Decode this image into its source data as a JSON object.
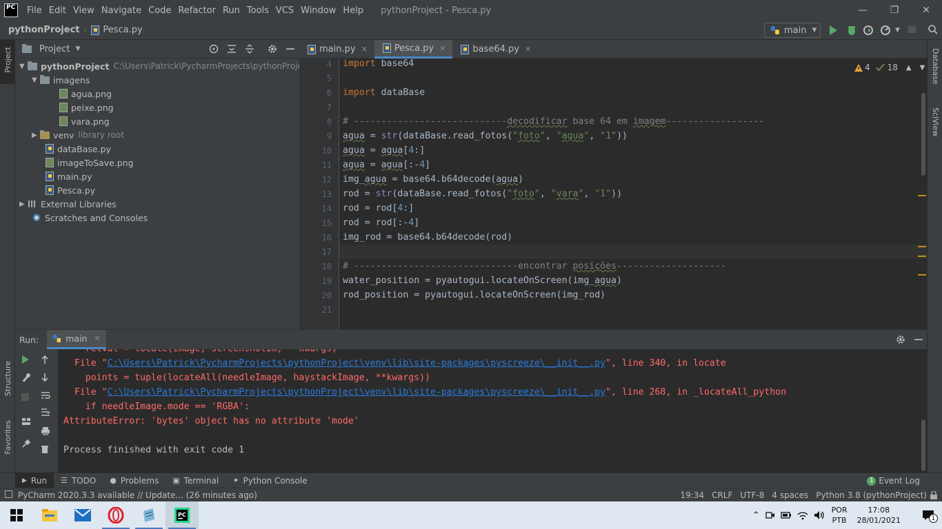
{
  "titlebar": {
    "logo": "PC",
    "menu": [
      "File",
      "Edit",
      "View",
      "Navigate",
      "Code",
      "Refactor",
      "Run",
      "Tools",
      "VCS",
      "Window",
      "Help"
    ],
    "window_title": "pythonProject - Pesca.py",
    "controls": {
      "minimize": "—",
      "restore": "❐",
      "close": "✕"
    }
  },
  "navbar": {
    "project": "pythonProject",
    "file": "Pesca.py",
    "run_config": "main"
  },
  "left_stripe": {
    "project": "Project",
    "structure": "Structure",
    "favorites": "Favorites"
  },
  "right_stripe": {
    "database": "Database",
    "sciview": "SciView"
  },
  "project_panel": {
    "title": "Project",
    "tree": {
      "root": "pythonProject",
      "root_path": "C:\\Users\\Patrick\\PycharmProjects\\pythonProject",
      "imagens": "imagens",
      "agua": "agua.png",
      "peixe": "peixe.png",
      "vara": "vara.png",
      "venv": "venv",
      "venv_note": "library root",
      "database": "dataBase.py",
      "imagetosave": "imageToSave.png",
      "main": "main.py",
      "pesca": "Pesca.py",
      "external": "External Libraries",
      "scratches": "Scratches and Consoles"
    }
  },
  "tabs": [
    {
      "label": "main.py",
      "active": false
    },
    {
      "label": "Pesca.py",
      "active": true
    },
    {
      "label": "base64.py",
      "active": false
    }
  ],
  "editor": {
    "warnings": "4",
    "weak_warnings": "18",
    "line_numbers": [
      "4",
      "5",
      "6",
      "7",
      "8",
      "9",
      "10",
      "11",
      "12",
      "13",
      "14",
      "15",
      "16",
      "17",
      "18",
      "19",
      "20",
      "21"
    ]
  },
  "run_panel": {
    "label": "Run:",
    "tab": "main",
    "console": {
      "l0": "    retval = locate(image, screenshotIm, **kwargs)",
      "l1_a": "  File \"",
      "l1_link": "C:\\Users\\Patrick\\PycharmProjects\\pythonProject\\venv\\lib\\site-packages\\pyscreeze\\__init__.py",
      "l1_b": "\", line 340, in locate",
      "l2": "    points = tuple(locateAll(needleImage, haystackImage, **kwargs))",
      "l3_a": "  File \"",
      "l3_link": "C:\\Users\\Patrick\\PycharmProjects\\pythonProject\\venv\\lib\\site-packages\\pyscreeze\\__init__.py",
      "l3_b": "\", line 268, in _locateAll_python",
      "l4": "    if needleImage.mode == 'RGBA':",
      "l5": "AttributeError: 'bytes' object has no attribute 'mode'",
      "l6": "Process finished with exit code 1"
    }
  },
  "tool_tabs": [
    {
      "label": "Run",
      "icon": "play-icon"
    },
    {
      "label": "TODO",
      "icon": "list-icon"
    },
    {
      "label": "Problems",
      "icon": "problems-icon"
    },
    {
      "label": "Terminal",
      "icon": "terminal-icon"
    },
    {
      "label": "Python Console",
      "icon": "python-icon"
    }
  ],
  "event_log": {
    "count": "1",
    "label": "Event Log"
  },
  "statusbar": {
    "message": "PyCharm 2020.3.3 available // Update... (26 minutes ago)",
    "position": "19:34",
    "line_sep": "CRLF",
    "encoding": "UTF-8",
    "indent": "4 spaces",
    "interpreter": "Python 3.8 (pythonProject)"
  },
  "taskbar": {
    "lang_1": "POR",
    "lang_2": "PTB",
    "time": "17:08",
    "date": "28/01/2021",
    "notifications": "1"
  },
  "colors": {
    "accent": "#4a88c7",
    "error": "#ff6b68",
    "link": "#287bde",
    "keyword": "#cc7832",
    "string": "#6a8759"
  }
}
